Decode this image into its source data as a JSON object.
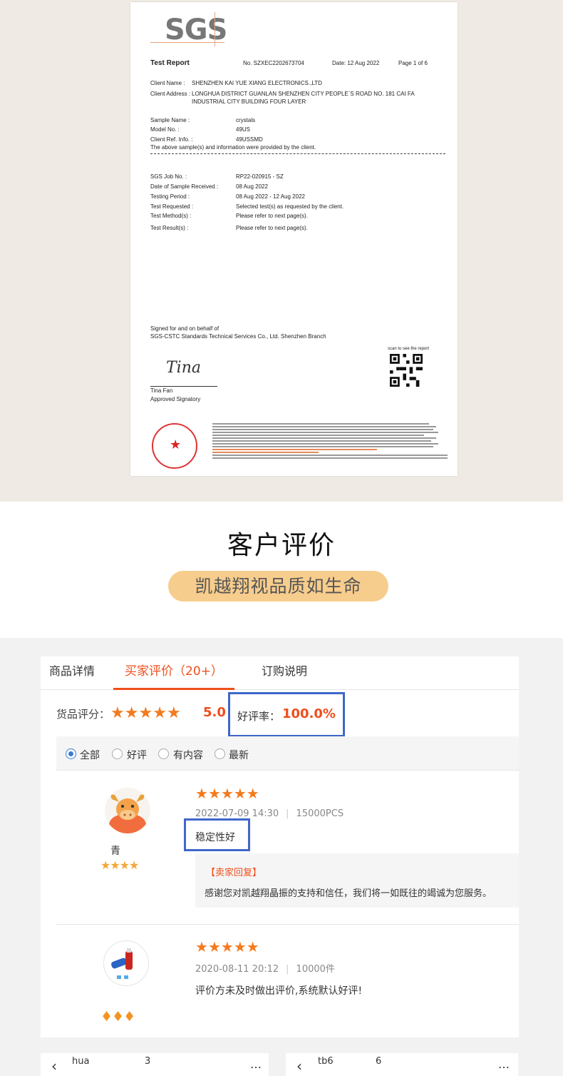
{
  "certificate": {
    "logo": "SGS",
    "title": "Test Report",
    "report_no": "No. SZXEC2202673704",
    "date": "Date: 12 Aug 2022",
    "page": "Page 1 of 6",
    "client_name_label": "Client Name :",
    "client_name": "SHENZHEN KAI YUE XIANG ELECTRONICS.,LTD",
    "client_address_label": "Client Address :",
    "client_address_1": "LONGHUA DISTRICT GUANLAN SHENZHEN CITY PEOPLE`S ROAD NO. 181 CAI FA",
    "client_address_2": "INDUSTRIAL CITY BUILDING FOUR LAYER",
    "sample_name_label": "Sample Name :",
    "sample_name": "crystals",
    "model_label": "Model No. :",
    "model": "49US",
    "client_ref_label": "Client Ref. Info. :",
    "client_ref": "49USSMD",
    "provided_note": "The above sample(s) and information were provided by the client.",
    "job_no_label": "SGS Job No. :",
    "job_no": "RP22-020915 - SZ",
    "received_label": "Date of Sample Received :",
    "received": "08 Aug 2022",
    "period_label": "Testing Period :",
    "period": "08 Aug 2022 - 12 Aug 2022",
    "requested_label": "Test Requested :",
    "requested": "Selected test(s) as requested by the client.",
    "method_label": "Test Method(s) :",
    "method": "Please refer to next page(s).",
    "result_label": "Test Result(s) :",
    "result": "Please refer to next page(s).",
    "signed_1": "Signed for and on behalf of",
    "signed_2": "SGS-CSTC Standards Technical Services Co., Ltd. Shenzhen Branch",
    "signature": "Tina",
    "signatory_name": "Tina Fan",
    "signatory_title": "Approved Signatory",
    "qr_caption": "scan to see the report"
  },
  "section": {
    "title": "客户评价",
    "slogan": "凯越翔视品质如生命"
  },
  "tabs": [
    {
      "label": "商品详情"
    },
    {
      "label": "买家评价（20+）"
    },
    {
      "label": "订购说明"
    }
  ],
  "rating": {
    "label": "货品评分：",
    "stars": 5,
    "score": "5.0",
    "good_rate_label": "好评率：",
    "good_rate": "100.0%"
  },
  "filters": [
    {
      "label": "全部",
      "selected": true
    },
    {
      "label": "好评",
      "selected": false
    },
    {
      "label": "有内容",
      "selected": false
    },
    {
      "label": "最新",
      "selected": false
    }
  ],
  "reviews": [
    {
      "user": "青",
      "stars": 5,
      "date": "2022-07-09 14:30",
      "qty": "15000PCS",
      "content": "稳定性好",
      "reply_title": "【卖家回复】",
      "reply_text": "感谢您对凯越翔晶振的支持和信任，我们将一如既往的竭诚为您服务。"
    },
    {
      "user": "",
      "stars": 5,
      "date": "2020-08-11 20:12",
      "qty": "10000件",
      "content": "评价方未及时做出评价,系统默认好评!"
    }
  ],
  "chats": [
    {
      "name": "hua",
      "suffix": "3"
    },
    {
      "name": "tb6",
      "suffix": "6"
    }
  ],
  "colors": {
    "accent": "#ef4f1c",
    "highlight_box": "#3f66c9",
    "slogan_pill": "#f7cd8d",
    "star": "#f47a1e"
  }
}
